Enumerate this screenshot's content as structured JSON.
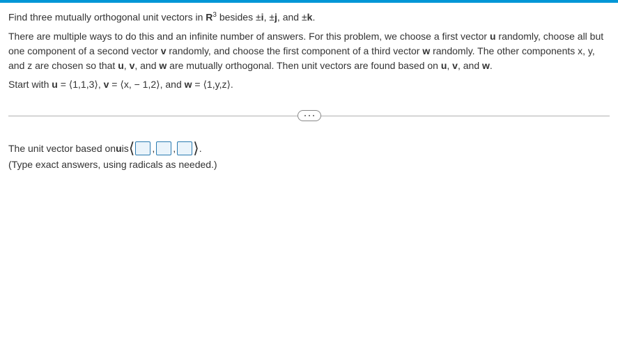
{
  "problem": {
    "line1_a": "Find three mutually orthogonal unit vectors in ",
    "line1_b": "R",
    "line1_sup": "3",
    "line1_c": " besides ±",
    "line1_i": "i",
    "line1_d": ", ±",
    "line1_j": "j",
    "line1_e": ", and ±",
    "line1_k": "k",
    "line1_f": ".",
    "para2_a": "There are multiple ways to do this and an infinite number of answers.  For this problem, we choose a first vector ",
    "para2_u": "u",
    "para2_b": " randomly, choose all but one component of a second vector ",
    "para2_v": "v",
    "para2_c": " randomly, and choose the first component of a third vector ",
    "para2_w": "w",
    "para2_d": " randomly. The other components x, y, and z are chosen so that ",
    "para2_u2": "u",
    "para2_e": ", ",
    "para2_v2": "v",
    "para2_f": ", and ",
    "para2_w2": "w",
    "para2_g": " are mutually orthogonal.  Then unit vectors are found based on ",
    "para2_u3": "u",
    "para2_h": ", ",
    "para2_v3": "v",
    "para2_i": ", and ",
    "para2_w3": "w",
    "para2_j": ".",
    "para3_a": "Start with ",
    "para3_u": "u",
    "para3_b": " = ⟨1,1,3⟩, ",
    "para3_v": "v",
    "para3_c": " = ⟨x, − 1,2⟩, and ",
    "para3_w": "w",
    "para3_d": " = ⟨1,y,z⟩."
  },
  "answer": {
    "prompt_a": "The unit vector based on ",
    "prompt_u": "u",
    "prompt_b": " is ",
    "open": "⟨",
    "comma": ",",
    "close": "⟩",
    "period": ".",
    "hint": "(Type exact answers, using radicals as needed.)"
  }
}
